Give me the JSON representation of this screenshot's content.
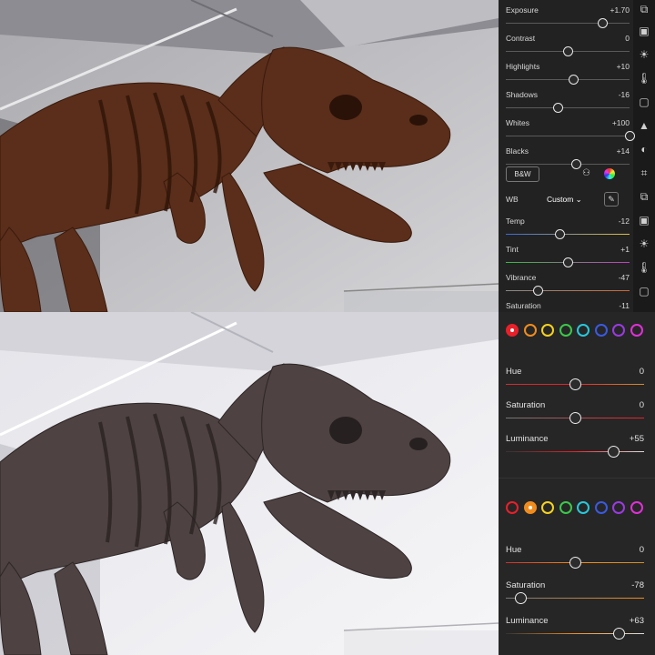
{
  "panel_top": {
    "sliders": [
      {
        "label": "Exposure",
        "value": "+1.70",
        "pos": 0.78
      },
      {
        "label": "Contrast",
        "value": "0",
        "pos": 0.5
      },
      {
        "label": "Highlights",
        "value": "+10",
        "pos": 0.55
      },
      {
        "label": "Shadows",
        "value": "-16",
        "pos": 0.42
      },
      {
        "label": "Whites",
        "value": "+100",
        "pos": 1.0
      },
      {
        "label": "Blacks",
        "value": "+14",
        "pos": 0.57
      },
      {
        "label": "Temp",
        "value": "-12",
        "pos": 0.44
      },
      {
        "label": "Tint",
        "value": "+1",
        "pos": 0.5
      },
      {
        "label": "Vibrance",
        "value": "-47",
        "pos": 0.26
      },
      {
        "label": "Saturation",
        "value": "-11",
        "pos": 0.44
      }
    ],
    "bw_label": "B&W",
    "wb_label": "WB",
    "wb_value": "Custom"
  },
  "panel_bottom_1": {
    "selected_color": "red",
    "sliders": [
      {
        "label": "Hue",
        "value": "0",
        "pos": 0.5
      },
      {
        "label": "Saturation",
        "value": "0",
        "pos": 0.5
      },
      {
        "label": "Luminance",
        "value": "+55",
        "pos": 0.78
      }
    ]
  },
  "panel_bottom_2": {
    "selected_color": "orange",
    "sliders": [
      {
        "label": "Hue",
        "value": "0",
        "pos": 0.5
      },
      {
        "label": "Saturation",
        "value": "-78",
        "pos": 0.11
      },
      {
        "label": "Luminance",
        "value": "+63",
        "pos": 0.82
      }
    ]
  },
  "swatch_colors": [
    "#e8202a",
    "#f08c1e",
    "#f5d21e",
    "#3cc84a",
    "#28c8dc",
    "#3a5ae0",
    "#9a3ae0",
    "#e030d8"
  ],
  "icons": [
    "copy-icon",
    "preset-icon",
    "light-icon",
    "color-temp-icon",
    "vignette-icon",
    "detail-icon",
    "optics-icon",
    "crop-icon"
  ],
  "colors": {
    "accent": "#ffffff",
    "panel_bg": "#222222"
  }
}
